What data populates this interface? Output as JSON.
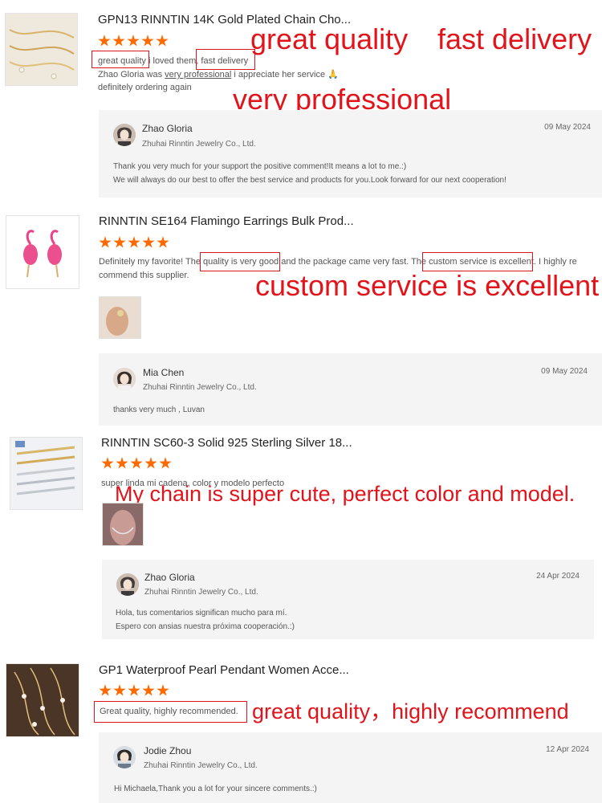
{
  "reviews": [
    {
      "product_title": "GPN13 RINNTIN 14K Gold Plated Chain Cho...",
      "rating": 5,
      "text_parts": [
        "great quality",
        " i loved them, ",
        "fast delivery"
      ],
      "text_line2_a": "Zhao Gloria was ",
      "text_line2_u": "very professional",
      "text_line2_b": " i appreciate her service 🙏",
      "text_line3": "definitely ordering again",
      "annotations": [
        "great quality",
        "fast delivery",
        "very professional"
      ],
      "reply": {
        "name": "Zhao Gloria",
        "company": "Zhuhai Rinntin Jewelry Co., Ltd.",
        "date": "09 May 2024",
        "line1": "Thank you very much for your support the positive comment!It means a lot to me.:)",
        "line2": "We will always do our best to offer the best service and products for you.Look forward for our next cooperation!"
      }
    },
    {
      "product_title": "RINNTIN SE164 Flamingo Earrings Bulk Prod...",
      "rating": 5,
      "text_a": "Definitely my favorite! The ",
      "text_b": "quality is very good",
      "text_c": " and the package came very fast. The ",
      "text_d": "custom service is excellent",
      "text_e": ". I highly re",
      "text_line2": "commend this supplier.",
      "annotation": "custom service is excellent",
      "reply": {
        "name": "Mia Chen",
        "company": "Zhuhai Rinntin Jewelry Co., Ltd.",
        "date": "09 May 2024",
        "line1": "thanks very much , Luvan"
      }
    },
    {
      "product_title": "RINNTIN SC60-3 Solid 925 Sterling Silver 18...",
      "rating": 5,
      "text": "super linda mi cadena, color y modelo perfecto",
      "annotation": "My chain is super cute, perfect color and model.",
      "reply": {
        "name": "Zhao Gloria",
        "company": "Zhuhai Rinntin Jewelry Co., Ltd.",
        "date": "24 Apr 2024",
        "line1": "Hola,   tus comentarios significan mucho para mí.",
        "line2": "Espero con ansias nuestra próxima cooperación.:)"
      }
    },
    {
      "product_title": "GP1 Waterproof Pearl Pendant Women Acce...",
      "rating": 5,
      "text": "Great quality, highly recommended.",
      "annotation": "great quality，highly recommend",
      "reply": {
        "name": "Jodie Zhou",
        "company": "Zhuhai Rinntin Jewelry Co., Ltd.",
        "date": "12 Apr 2024",
        "line1": "Hi Michaela,Thank you a lot for your sincere comments.:)"
      }
    }
  ],
  "colors": {
    "star": "#ff6a00",
    "annotation": "#e2141b",
    "reply_bg": "#f4f4f4"
  }
}
